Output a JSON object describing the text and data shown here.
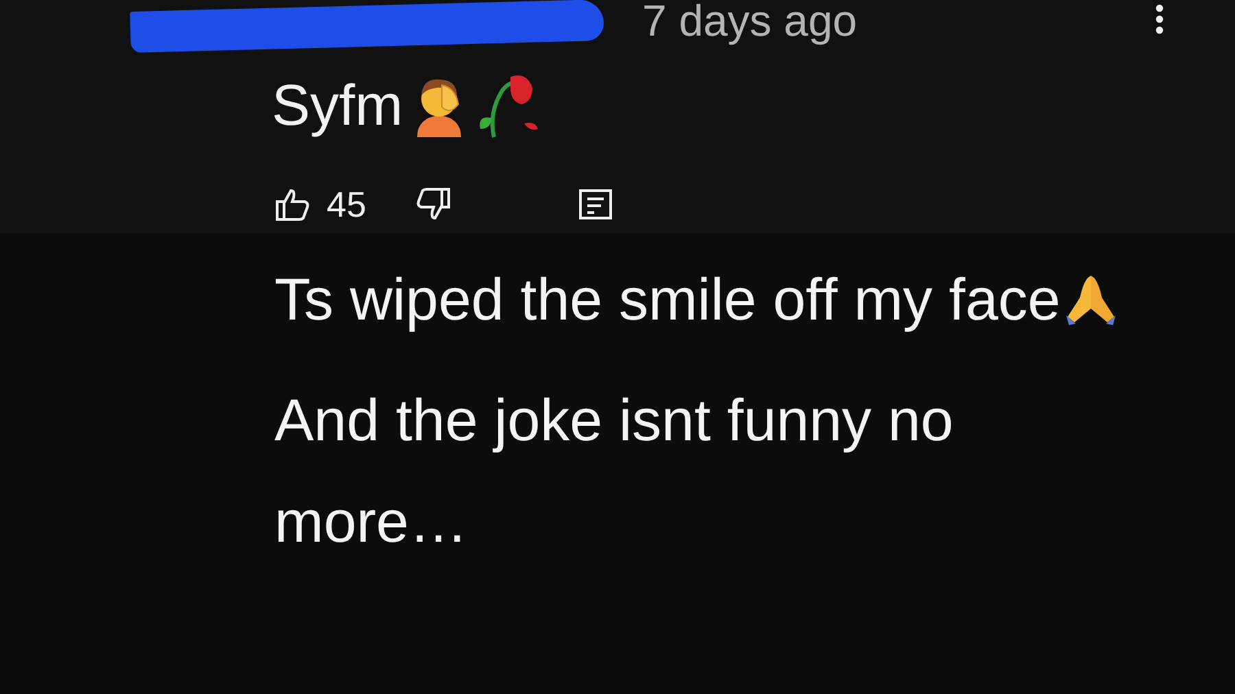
{
  "comment": {
    "time": "7 days ago",
    "text": "Syfm",
    "likes": "45"
  },
  "caption": {
    "paragraphs": [
      "Ts wiped the smile off my face",
      "And the joke isnt funny no more…"
    ]
  }
}
